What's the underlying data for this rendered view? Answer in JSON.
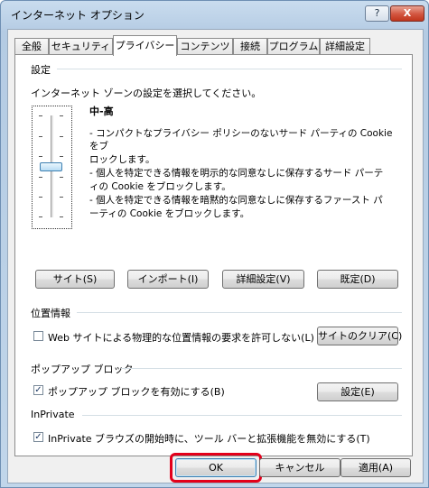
{
  "window": {
    "title": "インターネット オプション",
    "help_label": "?",
    "close_label": "X"
  },
  "tabs": [
    {
      "label": "全般"
    },
    {
      "label": "セキュリティ"
    },
    {
      "label": "プライバシー",
      "active": true
    },
    {
      "label": "コンテンツ"
    },
    {
      "label": "接続"
    },
    {
      "label": "プログラム"
    },
    {
      "label": "詳細設定"
    }
  ],
  "settings": {
    "group_label": "設定",
    "instruction": "インターネット ゾーンの設定を選択してください。",
    "slider_level_fraction": 0.5,
    "level_title": "中-高",
    "descriptions": [
      "- コンパクトなプライバシー ポリシーのないサード パーティの Cookie をブ",
      "ロックします。",
      "- 個人を特定できる情報を明示的な同意なしに保存するサード パーテ",
      "ィの Cookie をブロックします。",
      "- 個人を特定できる情報を暗黙的な同意なしに保存するファースト パ",
      "ーティの Cookie をブロックします。"
    ],
    "buttons": {
      "sites": "サイト(S)",
      "import": "インポート(I)",
      "advanced": "詳細設定(V)",
      "default": "既定(D)"
    }
  },
  "location": {
    "group_label": "位置情報",
    "checkbox_label": "Web サイトによる物理的な位置情報の要求を許可しない(L)",
    "checked": false,
    "clear_sites_button": "サイトのクリア(C)"
  },
  "popup": {
    "group_label": "ポップアップ ブロック",
    "checkbox_label": "ポップアップ ブロックを有効にする(B)",
    "checked": true,
    "settings_button": "設定(E)"
  },
  "inprivate": {
    "group_label": "InPrivate",
    "checkbox_label": "InPrivate ブラウズの開始時に、ツール バーと拡張機能を無効にする(T)",
    "checked": true
  },
  "footer": {
    "ok": "OK",
    "cancel": "キャンセル",
    "apply": "適用(A)"
  },
  "colors": {
    "highlight": "#e3001b"
  }
}
